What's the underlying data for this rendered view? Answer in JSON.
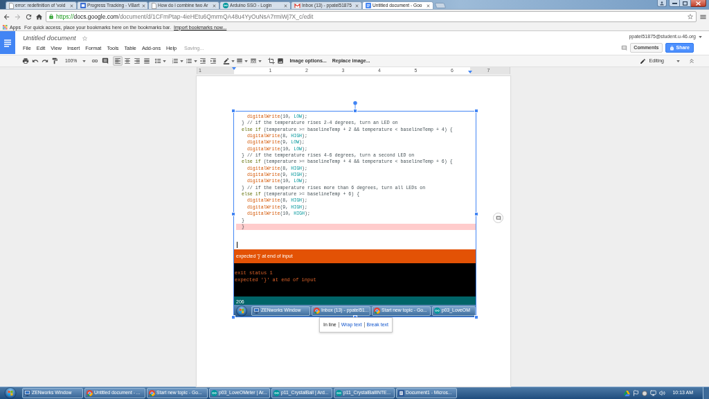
{
  "browser": {
    "tabs": [
      {
        "title": "error: redefinition of 'void",
        "kind": "page",
        "selected": false
      },
      {
        "title": "Progress Tracking - VBart",
        "kind": "app",
        "selected": false
      },
      {
        "title": "How do i combine two Ar",
        "kind": "page",
        "selected": false
      },
      {
        "title": "Arduino SSO - Login",
        "kind": "arduino",
        "selected": false
      },
      {
        "title": "Inbox (13) - ppatel51875",
        "kind": "mail",
        "selected": false
      },
      {
        "title": "Untitled document - Goo",
        "kind": "docs",
        "selected": true
      }
    ],
    "address": {
      "scheme": "https://",
      "host": "docs.google.com",
      "path": "/document/d/1CFmPtap-4ieHEtu6QmrmQA48u4YyOuNsA7rmiWj7X_c/edit"
    },
    "bookmarks_bar": {
      "apps": "Apps",
      "hint": "For quick access, place your bookmarks here on the bookmarks bar.",
      "import_link": "Import bookmarks now..."
    }
  },
  "document_header": {
    "title": "Untitled document",
    "starred": false,
    "menu": [
      "File",
      "Edit",
      "View",
      "Insert",
      "Format",
      "Tools",
      "Table",
      "Add-ons",
      "Help"
    ],
    "status": "Saving...",
    "account": "ppatel51875@student.u-46.org",
    "comments_button": "Comments",
    "share_button": "Share"
  },
  "toolbar": {
    "zoom": "100%",
    "align_buttons": [
      {
        "kind": "left",
        "selected": true
      },
      {
        "kind": "center",
        "selected": false
      },
      {
        "kind": "right",
        "selected": false
      },
      {
        "kind": "justify",
        "selected": false
      }
    ],
    "image_buttons": [
      "Image options...",
      "Replace image..."
    ],
    "mode": "Editing"
  },
  "ruler": {
    "numbers": [
      "1",
      "1",
      "2",
      "3",
      "4",
      "5",
      "6",
      "7"
    ]
  },
  "image": {
    "code_lines": [
      {
        "segments": [
          {
            "kind": "function",
            "text": "  digitalWrite"
          },
          {
            "kind": "plain",
            "text": "(10, "
          },
          {
            "kind": "constant",
            "text": "LOW"
          },
          {
            "kind": "plain",
            "text": ");"
          }
        ],
        "highlighted": false
      },
      {
        "segments": [
          {
            "kind": "plain",
            "text": "} // if the temperature rises 2-4 degrees, turn an LED on"
          }
        ],
        "highlighted": false
      },
      {
        "segments": [
          {
            "kind": "keyword",
            "text": "else if"
          },
          {
            "kind": "plain",
            "text": " (temperature >= baselineTemp + 2 && temperature < baselineTemp + 4) {"
          }
        ],
        "highlighted": false
      },
      {
        "segments": [
          {
            "kind": "function",
            "text": "  digitalWrite"
          },
          {
            "kind": "plain",
            "text": "(8, "
          },
          {
            "kind": "constant",
            "text": "HIGH"
          },
          {
            "kind": "plain",
            "text": ");"
          }
        ],
        "highlighted": false
      },
      {
        "segments": [
          {
            "kind": "function",
            "text": "  digitalWrite"
          },
          {
            "kind": "plain",
            "text": "(9, "
          },
          {
            "kind": "constant",
            "text": "LOW"
          },
          {
            "kind": "plain",
            "text": ");"
          }
        ],
        "highlighted": false
      },
      {
        "segments": [
          {
            "kind": "function",
            "text": "  digitalWrite"
          },
          {
            "kind": "plain",
            "text": "(10, "
          },
          {
            "kind": "constant",
            "text": "LOW"
          },
          {
            "kind": "plain",
            "text": ");"
          }
        ],
        "highlighted": false
      },
      {
        "segments": [
          {
            "kind": "plain",
            "text": "} // if the temperature rises 4-6 degrees, turn a second LED on"
          }
        ],
        "highlighted": false
      },
      {
        "segments": [
          {
            "kind": "keyword",
            "text": "else if"
          },
          {
            "kind": "plain",
            "text": " (temperature >= baselineTemp + 4 && temperature < baselineTemp + 6) {"
          }
        ],
        "highlighted": false
      },
      {
        "segments": [
          {
            "kind": "function",
            "text": "  digitalWrite"
          },
          {
            "kind": "plain",
            "text": "(8, "
          },
          {
            "kind": "constant",
            "text": "HIGH"
          },
          {
            "kind": "plain",
            "text": ");"
          }
        ],
        "highlighted": false
      },
      {
        "segments": [
          {
            "kind": "function",
            "text": "  digitalWrite"
          },
          {
            "kind": "plain",
            "text": "(9, "
          },
          {
            "kind": "constant",
            "text": "HIGH"
          },
          {
            "kind": "plain",
            "text": ");"
          }
        ],
        "highlighted": false
      },
      {
        "segments": [
          {
            "kind": "function",
            "text": "  digitalWrite"
          },
          {
            "kind": "plain",
            "text": "(10, "
          },
          {
            "kind": "constant",
            "text": "LOW"
          },
          {
            "kind": "plain",
            "text": ");"
          }
        ],
        "highlighted": false
      },
      {
        "segments": [
          {
            "kind": "plain",
            "text": "} // if the temperature rises more than 6 degrees, turn all LEDs on"
          }
        ],
        "highlighted": false
      },
      {
        "segments": [
          {
            "kind": "keyword",
            "text": "else if"
          },
          {
            "kind": "plain",
            "text": " (temperature >= baselineTemp + 6) {"
          }
        ],
        "highlighted": false
      },
      {
        "segments": [
          {
            "kind": "function",
            "text": "  digitalWrite"
          },
          {
            "kind": "plain",
            "text": "(8, "
          },
          {
            "kind": "constant",
            "text": "HIGH"
          },
          {
            "kind": "plain",
            "text": ");"
          }
        ],
        "highlighted": false
      },
      {
        "segments": [
          {
            "kind": "function",
            "text": "  digitalWrite"
          },
          {
            "kind": "plain",
            "text": "(9, "
          },
          {
            "kind": "constant",
            "text": "HIGH"
          },
          {
            "kind": "plain",
            "text": ");"
          }
        ],
        "highlighted": false
      },
      {
        "segments": [
          {
            "kind": "function",
            "text": "  digitalWrite"
          },
          {
            "kind": "plain",
            "text": "(10, "
          },
          {
            "kind": "constant",
            "text": "HIGH"
          },
          {
            "kind": "plain",
            "text": ");"
          }
        ],
        "highlighted": false
      },
      {
        "segments": [
          {
            "kind": "plain",
            "text": "}"
          }
        ],
        "highlighted": false
      },
      {
        "segments": [
          {
            "kind": "plain",
            "text": "}"
          }
        ],
        "highlighted": true
      }
    ],
    "error_banner": "expected '}' at end of input",
    "console_lines": [
      "exit status 1",
      "expected '}' at end of input"
    ],
    "status_line": "206",
    "taskbar": [
      {
        "label": "ZENworks Window",
        "kind": "zenworks"
      },
      {
        "label": "Inbox (13) - ppatel51...",
        "kind": "chrome"
      },
      {
        "label": "Start new topic - Go...",
        "kind": "chrome"
      },
      {
        "label": "p03_LoveOM",
        "kind": "arduino"
      }
    ]
  },
  "image_layout_menu": [
    {
      "label": "In line",
      "selected": true
    },
    {
      "label": "Wrap text",
      "selected": false
    },
    {
      "label": "Break text",
      "selected": false
    }
  ],
  "taskbar": {
    "items": [
      {
        "label": "ZENworks Window",
        "kind": "zenworks"
      },
      {
        "label": "Untitled document - ...",
        "kind": "chrome"
      },
      {
        "label": "Start new topic - Go...",
        "kind": "chrome"
      },
      {
        "label": "p03_LoveOMeter | Ar...",
        "kind": "arduino"
      },
      {
        "label": "p11_CrystalBall | Ard...",
        "kind": "arduino"
      },
      {
        "label": "p11_CrystalBallINTE...",
        "kind": "arduino"
      },
      {
        "label": "Document1 - Micros...",
        "kind": "word"
      }
    ],
    "clock": "10:13 AM"
  }
}
